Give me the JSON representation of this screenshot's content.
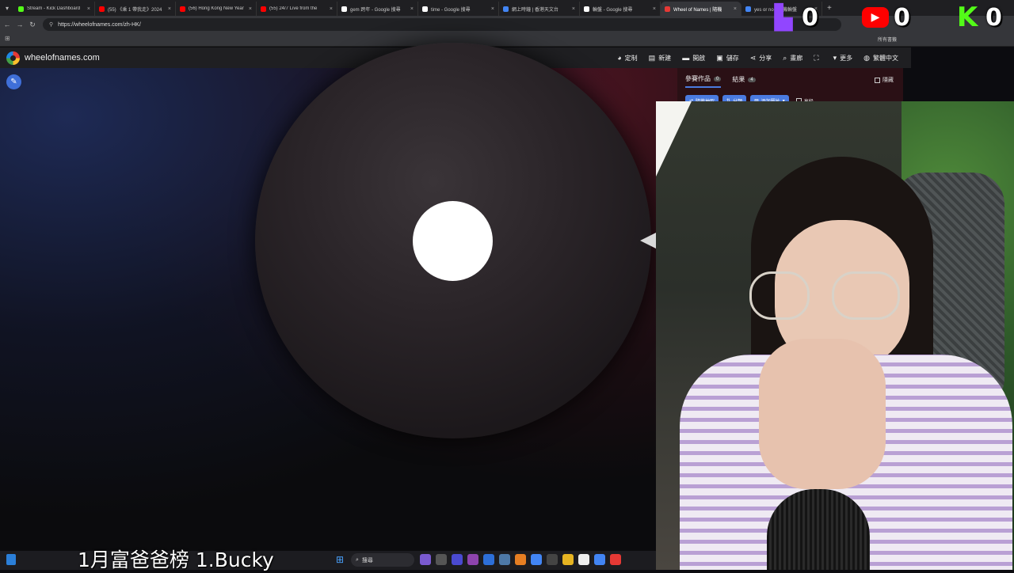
{
  "browser": {
    "tabs": [
      {
        "title": "Stream - Kick Dashboard",
        "color": "#53fc18",
        "active": false
      },
      {
        "title": "(55) 《乘 1 帶我走》2024",
        "color": "#ff0000",
        "active": false
      },
      {
        "title": "(56) Hong Kong New Year",
        "color": "#ff0000",
        "active": false
      },
      {
        "title": "(55) 24/7 Live from the",
        "color": "#ff0000",
        "active": false
      },
      {
        "title": "gem 跨年 - Google 搜尋",
        "color": "#ffffff",
        "active": false
      },
      {
        "title": "time - Google 搜尋",
        "color": "#ffffff",
        "active": false
      },
      {
        "title": "網上時鐘 | 香港天文台",
        "color": "#4285f4",
        "active": false
      },
      {
        "title": "輪盤 - Google 搜尋",
        "color": "#ffffff",
        "active": false
      },
      {
        "title": "Wheel of Names | 隨機",
        "color": "#e53935",
        "active": true
      },
      {
        "title": "yes or no - 隨機輪盤",
        "color": "#4285f4",
        "active": false
      }
    ],
    "new_tab": "+",
    "url": "https://wheelofnames.com/zh-HK/",
    "bookmarks_all": "所有書籤"
  },
  "app": {
    "site_name": "wheelofnames.com",
    "menu": [
      {
        "icon": "palette-icon",
        "glyph": "◕",
        "label": "定制"
      },
      {
        "icon": "new-file-icon",
        "glyph": "▤",
        "label": "新建"
      },
      {
        "icon": "folder-icon",
        "glyph": "▬",
        "label": "開啟"
      },
      {
        "icon": "save-icon",
        "glyph": "▣",
        "label": "儲存"
      },
      {
        "icon": "share-icon",
        "glyph": "⋖",
        "label": "分享"
      },
      {
        "icon": "search-icon",
        "glyph": "⌕",
        "label": "畫廊"
      },
      {
        "icon": "fullscreen-icon",
        "glyph": "⛶",
        "label": ""
      },
      {
        "icon": "more-icon",
        "glyph": "▾",
        "label": "更多"
      },
      {
        "icon": "globe-icon",
        "glyph": "◍",
        "label": "繁體中文"
      }
    ]
  },
  "panel": {
    "tab_entries": "參賽作品",
    "tab_entries_count": "0",
    "tab_results": "結果",
    "tab_results_count": "4",
    "hide_label": "隱藏",
    "shuffle_label": "隨機抽取",
    "sort_label": "分類",
    "add_image_label": "添加圖片",
    "advanced_label": "高級"
  },
  "counters": {
    "twitch": "0",
    "youtube": "0",
    "kick": "0"
  },
  "taskbar": {
    "search_placeholder": "搜尋"
  },
  "caption": "1月富爸爸榜  1.Bucky",
  "colors": {
    "accent": "#4a7be0",
    "twitch": "#9146ff",
    "youtube": "#ff0000",
    "kick": "#53fc18"
  }
}
